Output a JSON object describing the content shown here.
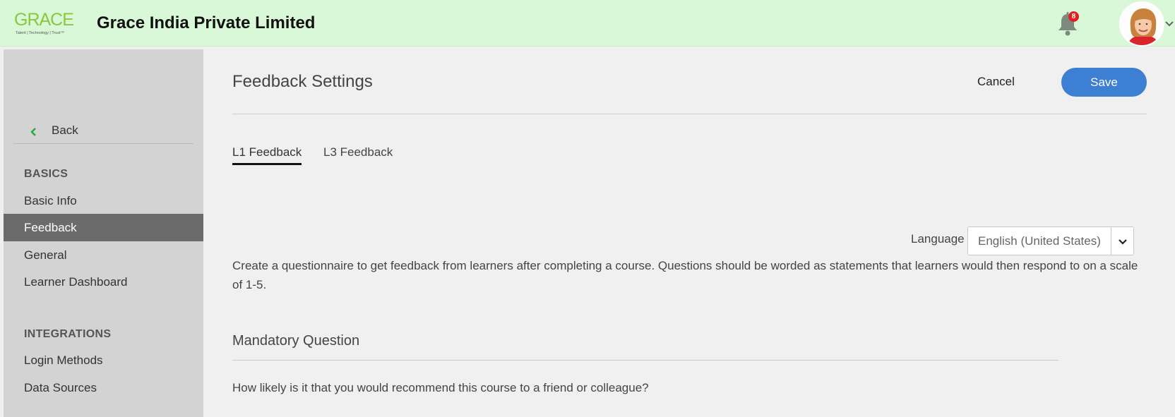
{
  "header": {
    "logo_word": "GRACE",
    "logo_tagline": "Talent | Technology | Trust™",
    "company_name": "Grace India Private Limited",
    "notification_count": "8",
    "colors": {
      "header_bg": "#d9f8d7",
      "logo_green": "#8cc63f",
      "badge_red": "#e02020"
    }
  },
  "sidebar": {
    "back_label": "Back",
    "sections": [
      {
        "title": "BASICS",
        "items": [
          "Basic Info",
          "Feedback",
          "General",
          "Learner Dashboard"
        ]
      },
      {
        "title": "INTEGRATIONS",
        "items": [
          "Login Methods",
          "Data Sources"
        ]
      }
    ],
    "active_item": "Feedback"
  },
  "main": {
    "page_title": "Feedback Settings",
    "cancel_label": "Cancel",
    "save_label": "Save",
    "tabs": [
      {
        "label": "L1 Feedback",
        "active": true
      },
      {
        "label": "L3 Feedback",
        "active": false
      }
    ],
    "language": {
      "label": "Language",
      "value": "English (United States)"
    },
    "description": "Create a questionnaire to get feedback from learners after completing a course. Questions should be worded as statements that learners would then respond to on a scale of 1-5.",
    "mandatory_title": "Mandatory Question",
    "mandatory_question": "How likely is it that you would recommend this course to a friend or colleague?",
    "colors": {
      "save_button": "#3d7fd3",
      "active_sidebar": "#6b6b6b",
      "back_chevron": "#2aa836"
    }
  }
}
